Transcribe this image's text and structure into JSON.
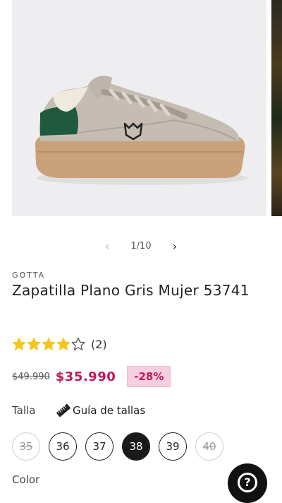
{
  "gallery": {
    "counter": "1/10",
    "prev_icon": "chevron-left-icon",
    "next_icon": "chevron-right-icon",
    "image": "grey-sneaker-with-green-heel-tab"
  },
  "product": {
    "vendor": "GOTTA",
    "title": "Zapatilla Plano Gris Mujer 53741"
  },
  "rating": {
    "value": 4,
    "max": 5,
    "count": "(2)",
    "star_color": "#f5c518"
  },
  "price": {
    "compare": "$49.990",
    "sale": "$35.990",
    "discount": "-28%",
    "sale_color": "#c2185b",
    "badge_bg": "#f5cfe0"
  },
  "size": {
    "label": "Talla",
    "guide_label": "Guía de tallas",
    "guide_icon": "ruler-icon",
    "options": [
      {
        "label": "35",
        "state": "unavailable"
      },
      {
        "label": "36",
        "state": "available"
      },
      {
        "label": "37",
        "state": "available"
      },
      {
        "label": "38",
        "state": "selected"
      },
      {
        "label": "39",
        "state": "available"
      },
      {
        "label": "40",
        "state": "unavailable"
      }
    ]
  },
  "color": {
    "label": "Color"
  },
  "help": {
    "icon": "question-icon",
    "glyph": "?"
  }
}
